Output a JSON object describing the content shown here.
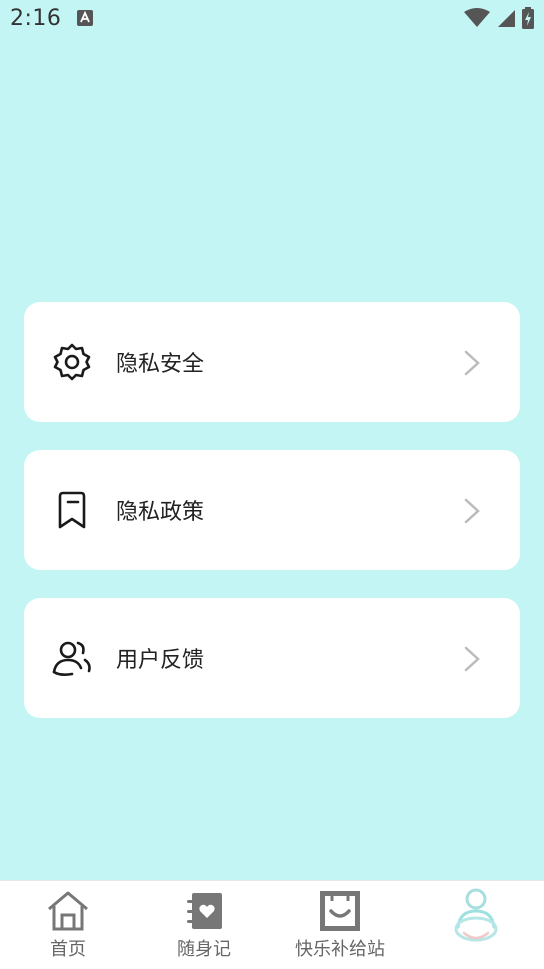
{
  "status_bar": {
    "time": "2:16"
  },
  "menu": {
    "items": [
      {
        "label": "隐私安全",
        "icon": "gear-icon"
      },
      {
        "label": "隐私政策",
        "icon": "bookmark-icon"
      },
      {
        "label": "用户反馈",
        "icon": "users-icon"
      }
    ]
  },
  "tabbar": {
    "tabs": [
      {
        "label": "首页",
        "icon": "home-icon"
      },
      {
        "label": "随身记",
        "icon": "notebook-heart-icon"
      },
      {
        "label": "快乐补给站",
        "icon": "smile-box-icon"
      },
      {
        "label": "",
        "icon": "profile-icon",
        "active": true
      }
    ]
  },
  "colors": {
    "background": "#c4f5f5",
    "card": "#ffffff",
    "icon": "#1a1a1a",
    "chevron": "#bbbbbb",
    "tab_label": "#666666"
  }
}
